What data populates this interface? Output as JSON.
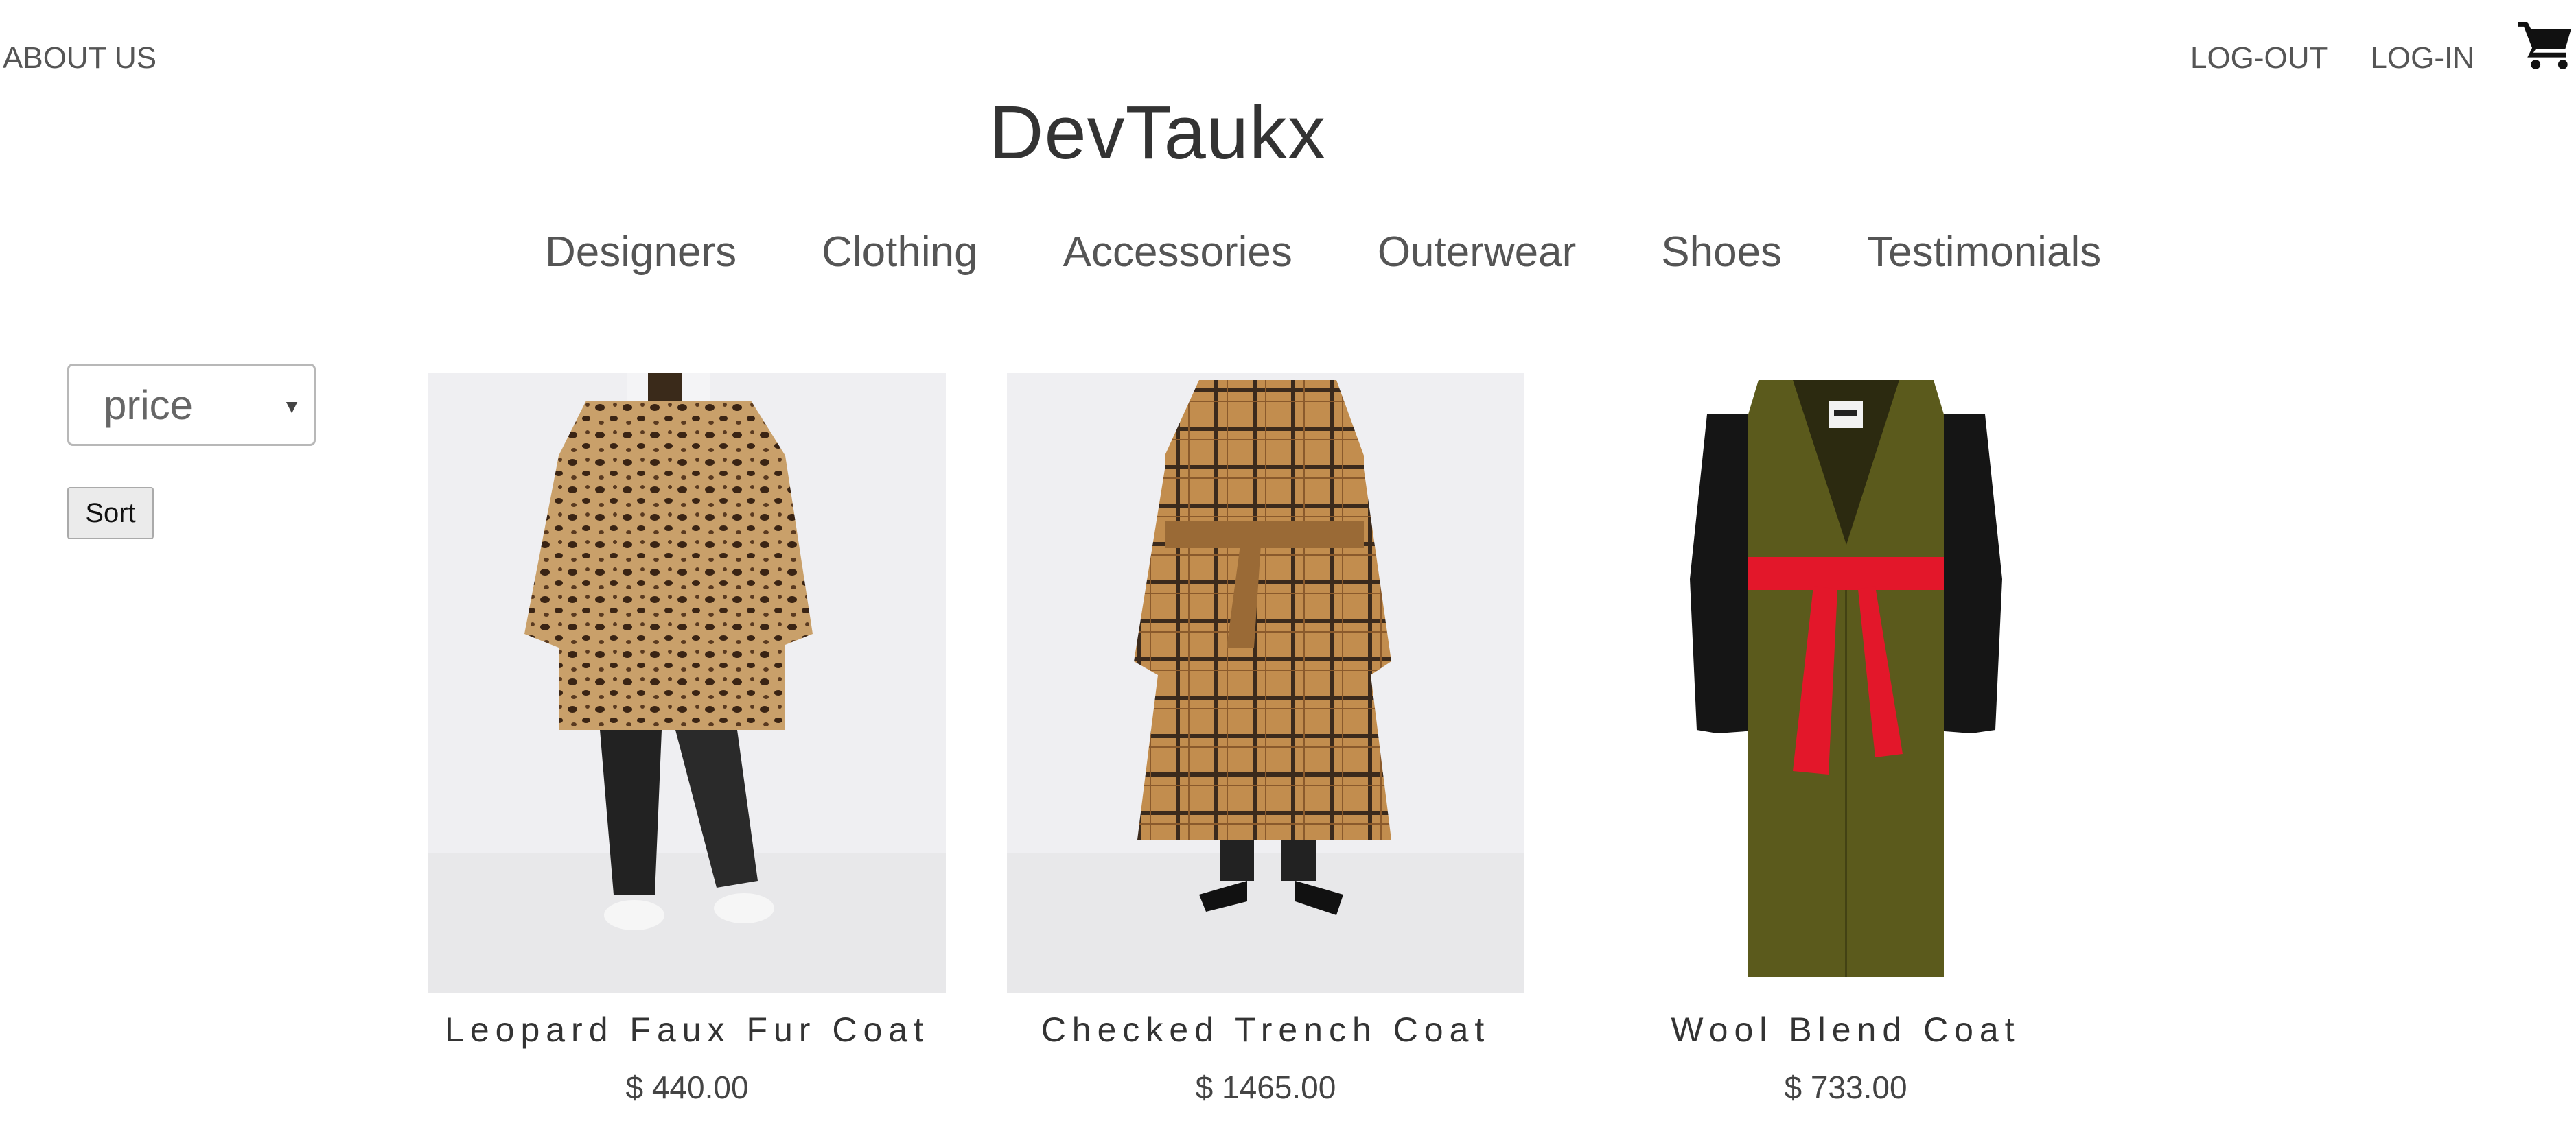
{
  "header": {
    "about_label": "ABOUT US",
    "logout_label": "LOG-OUT",
    "login_label": "LOG-IN",
    "cart_icon": "shopping-cart-icon",
    "brand": "DevTaukx"
  },
  "nav": {
    "items": [
      {
        "label": "Designers"
      },
      {
        "label": "Clothing"
      },
      {
        "label": "Accessories"
      },
      {
        "label": "Outerwear"
      },
      {
        "label": "Shoes"
      },
      {
        "label": "Testimonials"
      }
    ]
  },
  "sort": {
    "selected": "price",
    "button_label": "Sort"
  },
  "products": [
    {
      "name": "Leopard Faux Fur Coat",
      "price": "$ 440.00"
    },
    {
      "name": "Checked Trench Coat",
      "price": "$ 1465.00"
    },
    {
      "name": "Wool Blend Coat",
      "price": "$ 733.00"
    }
  ],
  "colors": {
    "olive": "#5b5a1c",
    "red_belt": "#e3172a",
    "leopard_base": "#c9a06a",
    "plaid_base": "#c28d4e"
  }
}
